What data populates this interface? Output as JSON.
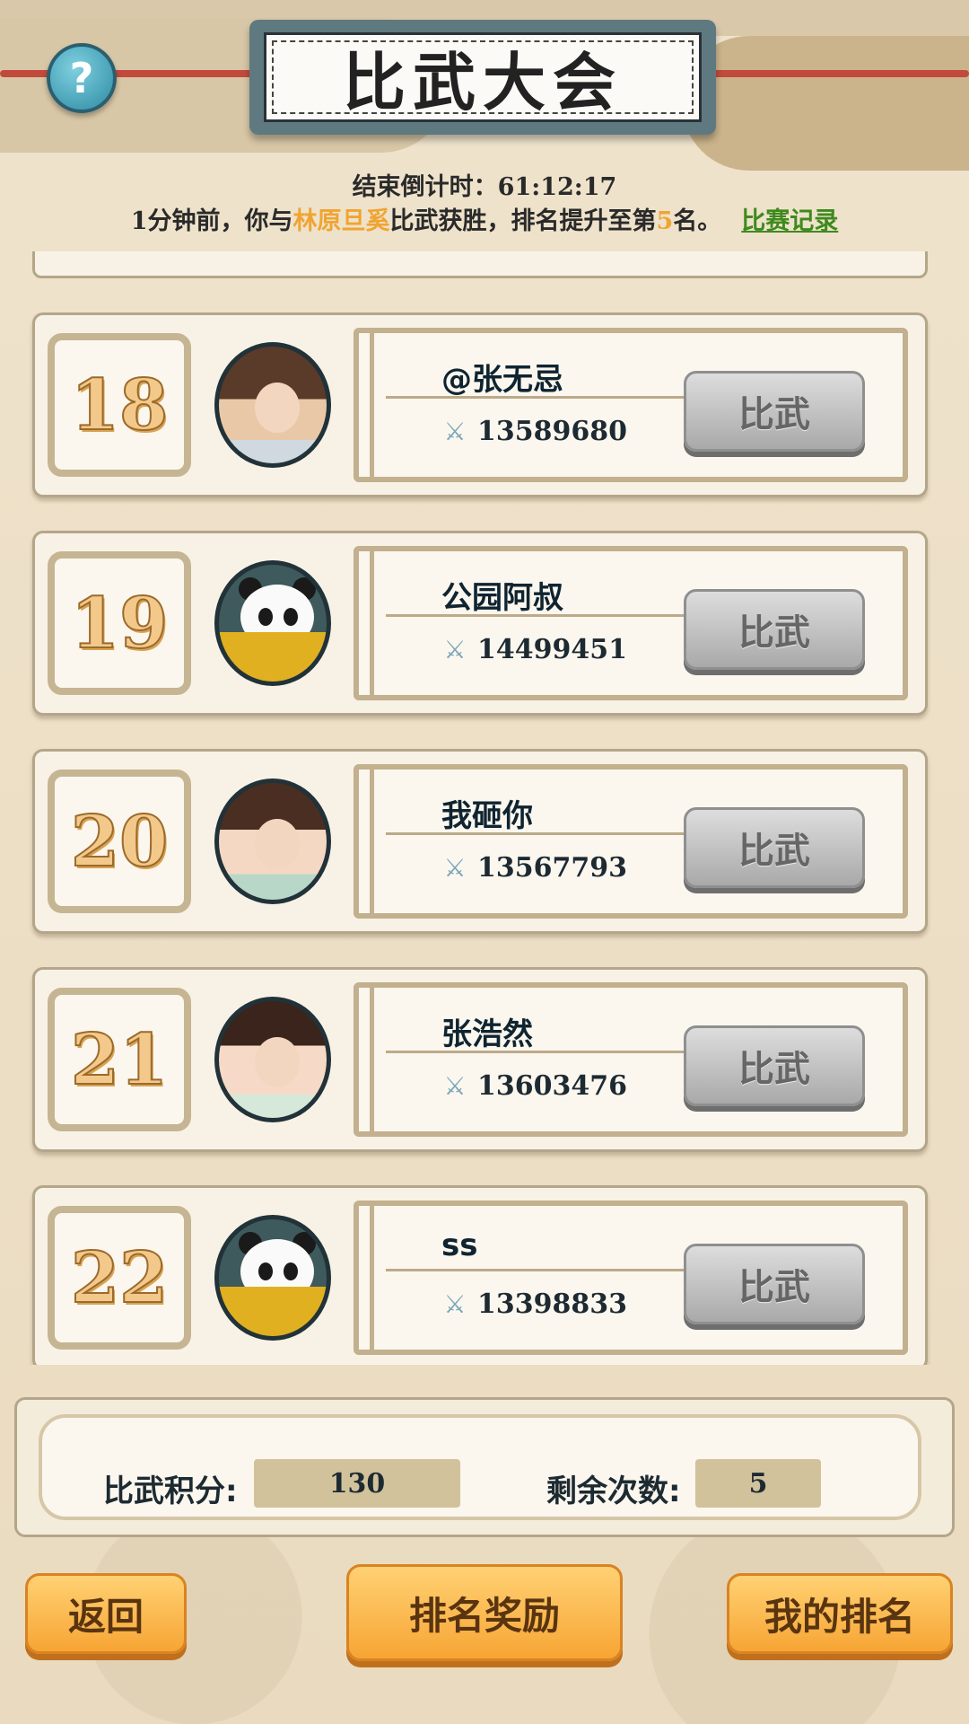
{
  "header": {
    "title": "比武大会",
    "help_icon": "?"
  },
  "countdown": {
    "label": "结束倒计时：",
    "time": "61:12:17"
  },
  "notice": {
    "prefix": "1分钟前，你与",
    "opponent": "林原旦奚",
    "middle": "比武获胜，排名提升至第",
    "rank": "5",
    "suffix": "名。",
    "link": "比赛记录"
  },
  "rankings": [
    {
      "rank": "18",
      "name": "@张无忌",
      "power": "13589680",
      "avatar": "man-avatar",
      "button": "比武"
    },
    {
      "rank": "19",
      "name": "公园阿叔",
      "power": "14499451",
      "avatar": "panda-avatar",
      "button": "比武"
    },
    {
      "rank": "20",
      "name": "我砸你",
      "power": "13567793",
      "avatar": "girl-avatar",
      "button": "比武"
    },
    {
      "rank": "21",
      "name": "张浩然",
      "power": "13603476",
      "avatar": "girl2-avatar",
      "button": "比武"
    },
    {
      "rank": "22",
      "name": "ss",
      "power": "13398833",
      "avatar": "panda-avatar",
      "button": "比武"
    }
  ],
  "stats": {
    "points_label": "比武积分:",
    "points_value": "130",
    "remaining_label": "剩余次数:",
    "remaining_value": "5"
  },
  "buttons": {
    "back": "返回",
    "rank_reward": "排名奖励",
    "my_rank": "我的排名"
  },
  "colors": {
    "highlight": "#f0a431",
    "link": "#3e8a1e",
    "button_orange": "#f7a534"
  }
}
